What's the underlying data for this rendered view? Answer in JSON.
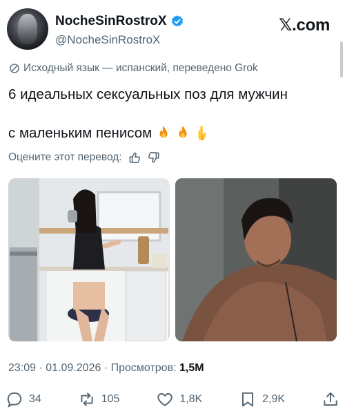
{
  "author": {
    "name": "NocheSinRostroX",
    "handle": "@NocheSinRostroX"
  },
  "brand": "𝕏.com",
  "translation_note": "Исходный язык — испанский, переведено Grok",
  "post": {
    "line1": "6 идеальных сексуальных поз для мужчин",
    "line2": "с маленьким пенисом"
  },
  "rate_label": "Оцените этот перевод:",
  "timestamp": {
    "time": "23:09",
    "date": "01.09.2026",
    "views_label": "Просмотров:",
    "views": "1,5M"
  },
  "actions": {
    "replies": "34",
    "reposts": "105",
    "likes": "1,8K",
    "bookmarks": "2,9K"
  },
  "icons": {
    "verified": "verified-badge-icon",
    "translate": "translate-icon",
    "emojis": [
      "fire-icon",
      "fire-icon",
      "point-down-icon"
    ]
  },
  "colors": {
    "verified": "#1d9bf0",
    "muted": "#536471",
    "text": "#0f1419"
  }
}
